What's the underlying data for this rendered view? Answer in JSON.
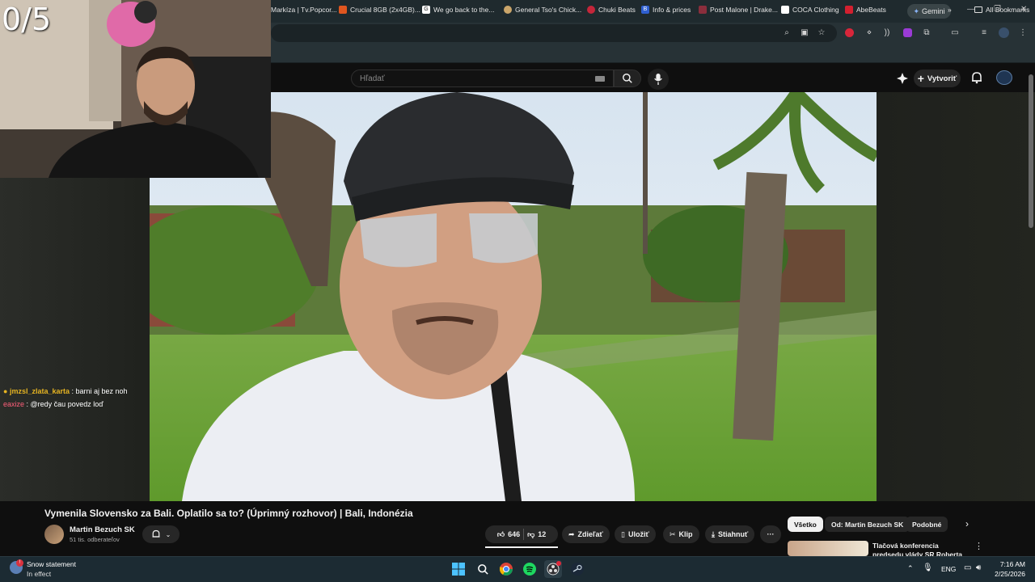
{
  "browser": {
    "gemini_label": "Gemini",
    "bookmarks": [
      {
        "label": "Markíza | Tv.Popcor...",
        "color": "#6b7b80"
      },
      {
        "label": "Crucial 8GB (2x4GB)...",
        "color": "#e0561f"
      },
      {
        "label": "We go back to the...",
        "color": "#ffffff"
      },
      {
        "label": "General Tso's Chick...",
        "color": "#caa56a"
      },
      {
        "label": "Chuki Beats",
        "color": "#c4263a"
      },
      {
        "label": "Info & prices",
        "color": "#2f5fd0"
      },
      {
        "label": "Post Malone | Drake...",
        "color": "#8a2e3c"
      },
      {
        "label": "COCA Clothing",
        "color": "#ffffff"
      },
      {
        "label": "AbeBeats",
        "color": "#d3202f"
      }
    ],
    "all_bookmarks": "All Bookmarks"
  },
  "youtube": {
    "search_placeholder": "Hľadať",
    "create_label": "Vytvoriť",
    "video_title": "Vymenila Slovensko za Bali. Oplatilo sa to? (Úprimný rozhovor) | Bali, Indonézia",
    "channel_name": "Martin Bezuch SK",
    "subscribers": "51 tis. odberateľov",
    "likes": "646",
    "dislikes": "12",
    "share_label": "Zdieľať",
    "save_label": "Uložiť",
    "clip_label": "Klip",
    "download_label": "Stiahnuť",
    "chips": [
      "Všetko",
      "Od: Martin Bezuch SK",
      "Podobné"
    ],
    "rec_title": "Tlačová konferencia predsedu vlády SR Roberta Fica po..."
  },
  "stream": {
    "counter": "0/5",
    "chat": [
      {
        "user": "jmzsl_zlata_karta",
        "text": ": barni aj bez noh"
      },
      {
        "user": "eaxize",
        "text": ": @redy čau povedz loď"
      }
    ]
  },
  "taskbar": {
    "weather_title": "Snow statement",
    "weather_sub": "In effect",
    "lang": "ENG",
    "time": "7:16 AM",
    "date": "2/25/2026"
  }
}
